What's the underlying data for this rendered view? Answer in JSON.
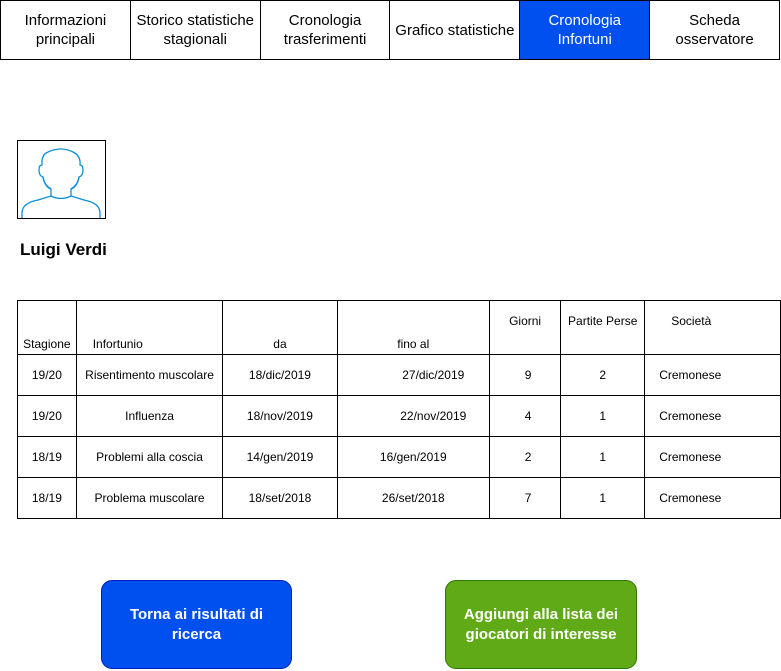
{
  "tabs": [
    {
      "label": "Informazioni principali"
    },
    {
      "label": "Storico statistiche stagionali"
    },
    {
      "label": "Cronologia trasferimenti"
    },
    {
      "label": "Grafico statistiche"
    },
    {
      "label": "Cronologia Infortuni"
    },
    {
      "label": "Scheda osservatore"
    }
  ],
  "player": {
    "name": "Luigi Verdi"
  },
  "table": {
    "headers": [
      "Stagione",
      "Infortunio",
      "da",
      "fino al",
      "Giorni",
      "Partite Perse",
      "Società"
    ],
    "rows": [
      [
        "19/20",
        "Risentimento muscolare",
        "18/dic/2019",
        "27/dic/2019",
        "9",
        "2",
        "Cremonese"
      ],
      [
        "19/20",
        "Influenza",
        "18/nov/2019",
        "22/nov/2019",
        "4",
        "1",
        "Cremonese"
      ],
      [
        "18/19",
        "Problemi alla coscia",
        "14/gen/2019",
        "16/gen/2019",
        "2",
        "1",
        "Cremonese"
      ],
      [
        "18/19",
        "Problema muscolare",
        "18/set/2018",
        "26/set/2018",
        "7",
        "1",
        "Cremonese"
      ]
    ]
  },
  "buttons": {
    "back": "Torna ai risultati di ricerca",
    "add": "Aggiungi alla lista dei giocatori di interesse"
  },
  "colors": {
    "accent": "#0050ef",
    "success": "#60a917",
    "avatar": "#0b8fd8"
  },
  "icons": {
    "avatar": "user-icon"
  }
}
